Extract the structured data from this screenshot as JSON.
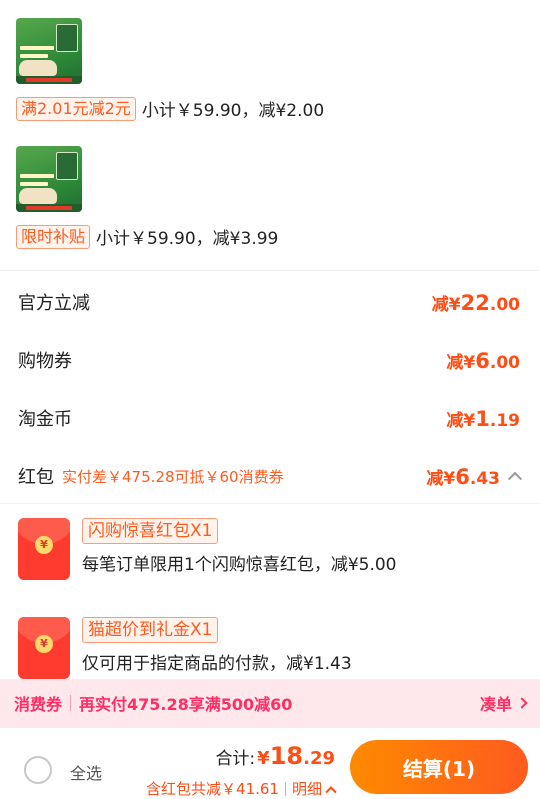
{
  "products": [
    {
      "promo_tag": "满2.01元减2元",
      "promo_text": "小计￥59.90，减¥2.00"
    },
    {
      "promo_tag": "限时补贴",
      "promo_text": "小计￥59.90，减¥3.99"
    }
  ],
  "discounts": [
    {
      "label": "官方立减",
      "prefix": "减¥",
      "int": "22",
      "dec": ".00"
    },
    {
      "label": "购物券",
      "prefix": "减¥",
      "int": "6",
      "dec": ".00"
    },
    {
      "label": "淘金币",
      "prefix": "减¥",
      "int": "1",
      "dec": ".19"
    },
    {
      "label": "红包",
      "note": "实付差￥475.28可抵￥60消费券",
      "prefix": "减¥",
      "int": "6",
      "dec": ".43"
    }
  ],
  "red_packets": [
    {
      "title": "闪购惊喜红包X1",
      "desc": "每笔订单限用1个闪购惊喜红包，减¥5.00",
      "coin": "¥"
    },
    {
      "title": "猫超价到礼金X1",
      "desc": "仅可用于指定商品的付款，减¥1.43",
      "coin": "¥"
    }
  ],
  "coupon": {
    "label": "消费券",
    "text": "再实付475.28享满500减60",
    "link": "凑单"
  },
  "footer": {
    "select_all": "全选",
    "total_label": "合计:",
    "total_yen": "¥",
    "total_int": "18",
    "total_dec": ".29",
    "sub_text": "含红包共减￥41.61",
    "detail": "明细",
    "checkout": "结算(1)"
  },
  "colors": {
    "accent": "#ff4d14",
    "coupon": "#ff2e63",
    "packet": "#ff3b30"
  }
}
